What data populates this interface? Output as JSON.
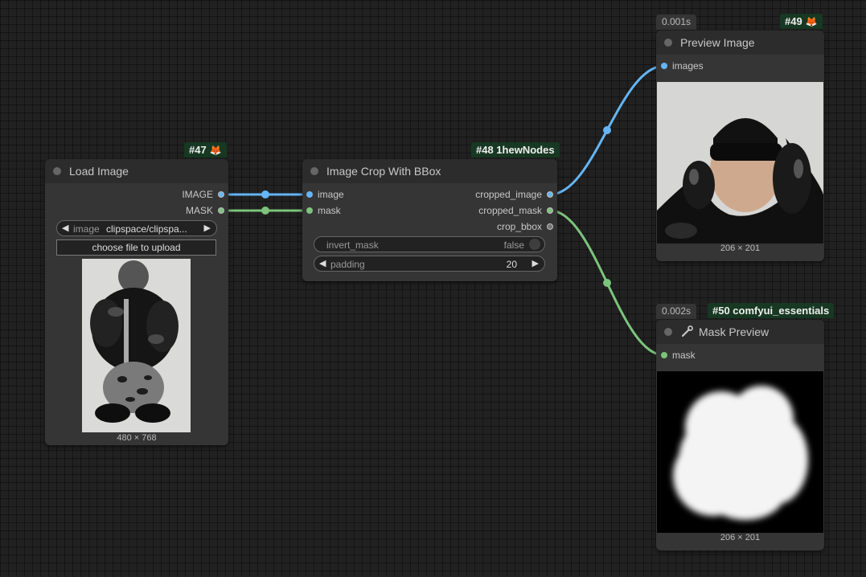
{
  "nodes": {
    "load_image": {
      "badge": "#47",
      "badge_icon": "fox-icon",
      "title": "Load Image",
      "outputs": [
        "IMAGE",
        "MASK"
      ],
      "image_widget": {
        "label": "image",
        "value": "clipspace/clipspa..."
      },
      "upload_label": "choose file to upload",
      "preview_dims": "480 × 768"
    },
    "crop": {
      "badge": "#48 1hewNodes",
      "title": "Image Crop With BBox",
      "inputs": [
        "image",
        "mask"
      ],
      "outputs": [
        "cropped_image",
        "cropped_mask",
        "crop_bbox"
      ],
      "invert_mask": {
        "label": "invert_mask",
        "value": "false"
      },
      "padding": {
        "label": "padding",
        "value": "20"
      }
    },
    "preview": {
      "time": "0.001s",
      "badge": "#49",
      "badge_icon": "fox-icon",
      "title": "Preview Image",
      "inputs": [
        "images"
      ],
      "preview_dims": "206 × 201"
    },
    "mask_preview": {
      "time": "0.002s",
      "badge": "#50 comfyui_essentials",
      "title": "Mask Preview",
      "title_icon": "wrench-icon",
      "inputs": [
        "mask"
      ],
      "preview_dims": "206 × 201"
    }
  },
  "colors": {
    "image_link": "#64b5f6",
    "mask_link": "#7cc47c",
    "badge_bg": "#173822",
    "node_bg": "#353535",
    "canvas_bg": "#212121"
  }
}
